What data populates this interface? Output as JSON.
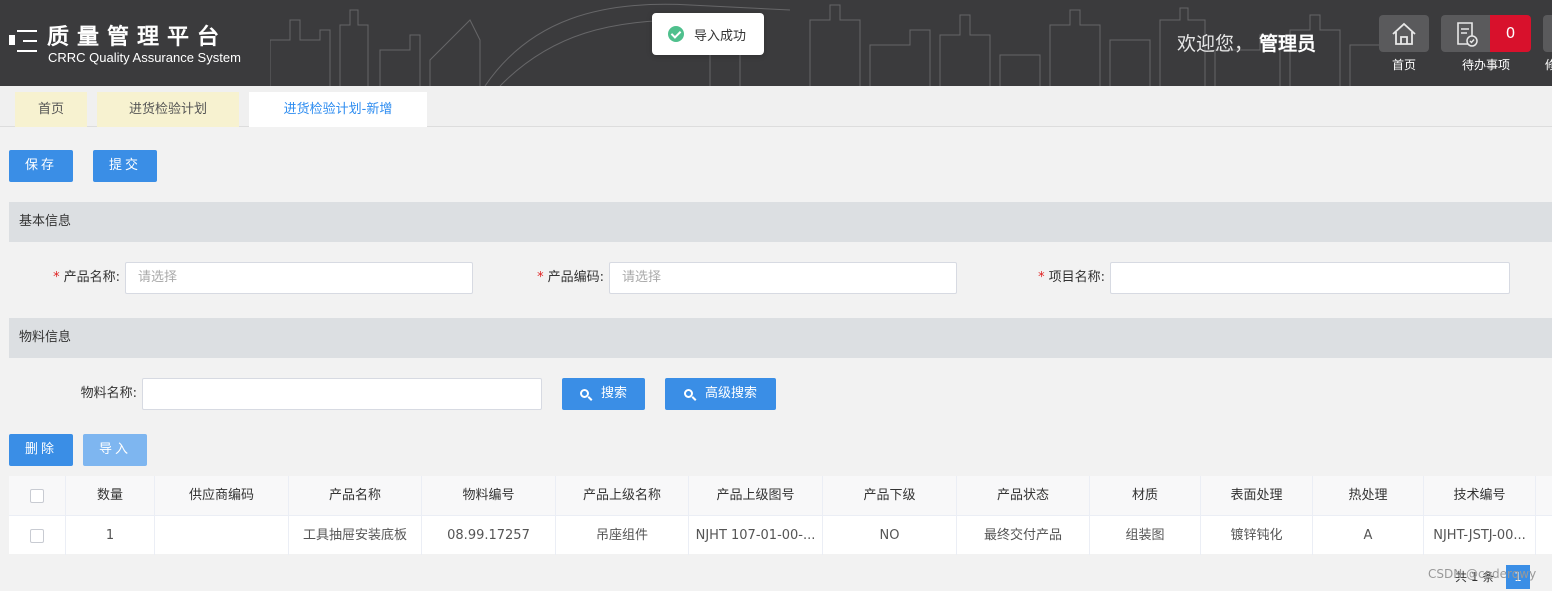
{
  "header": {
    "title": "质量管理平台",
    "subtitle": "CRRC Quality Assurance System",
    "welcome_prefix": "欢迎您，",
    "user": "管理员",
    "home_label": "首页",
    "todo_label": "待办事项",
    "todo_count": "0",
    "cut_label": "修"
  },
  "toast": {
    "message": "导入成功"
  },
  "tabs": [
    {
      "label": "首页"
    },
    {
      "label": "进货检验计划"
    },
    {
      "label": "进货检验计划-新增"
    }
  ],
  "actions": {
    "save": "保存",
    "submit": "提交"
  },
  "basic_info": {
    "section_title": "基本信息",
    "product_name_label": "产品名称:",
    "product_name_placeholder": "请选择",
    "product_code_label": "产品编码:",
    "product_code_placeholder": "请选择",
    "project_name_label": "项目名称:",
    "project_name_value": ""
  },
  "material_info": {
    "section_title": "物料信息",
    "material_name_label": "物料名称:",
    "material_name_value": "",
    "search": "搜索",
    "advanced_search": "高级搜索",
    "delete": "删除",
    "import": "导入"
  },
  "table": {
    "columns": [
      "数量",
      "供应商编码",
      "产品名称",
      "物料编号",
      "产品上级名称",
      "产品上级图号",
      "产品下级",
      "产品状态",
      "材质",
      "表面处理",
      "热处理",
      "技术编号"
    ],
    "rows": [
      [
        "1",
        "",
        "工具抽屉安装底板",
        "08.99.17257",
        "吊座组件",
        "NJHT 107-01-00-...",
        "NO",
        "最终交付产品",
        "组装图",
        "镀锌钝化",
        "A",
        "NJHT-JSTJ-00..."
      ]
    ]
  },
  "footer": {
    "watermark": "CSDN @coderqwy",
    "total_text": "共 1 条",
    "page": "1"
  },
  "colors": {
    "primary": "#3a8ee6",
    "header_bg": "#3b3b3d",
    "badge": "#d8112c",
    "success": "#4fc08d"
  }
}
